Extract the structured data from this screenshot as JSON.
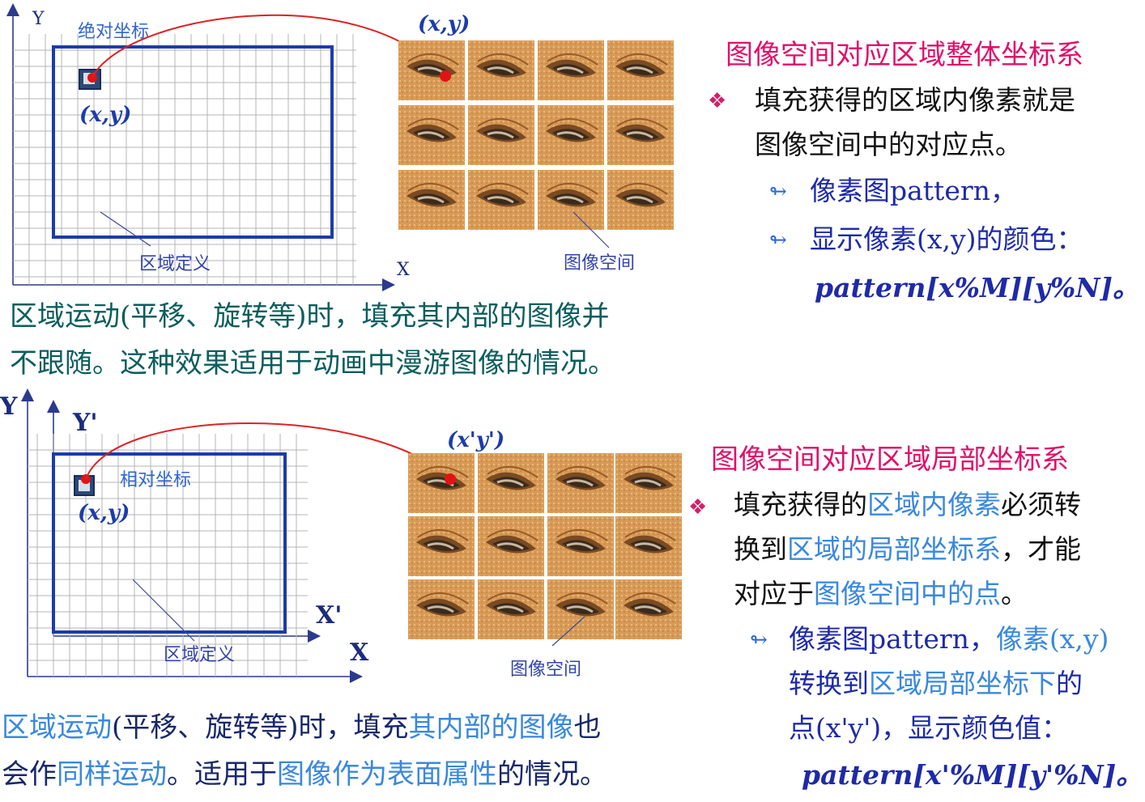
{
  "top": {
    "axis_y": "Y",
    "axis_x": "X",
    "abs_coord_label": "绝对坐标",
    "point_label": "(x,y)",
    "pattern_point_label": "(x,y)",
    "region_label": "区域定义",
    "image_space_label": "图像空间",
    "heading": "图像空间对应区域整体坐标系",
    "bullet_line1": "填充获得的区域内像素就是",
    "bullet_line2": "图像空间中的对应点。",
    "sub1": "像素图pattern，",
    "sub2": "显示像素(x,y)的颜色：",
    "formula": "pattern[x%M][y%N]。",
    "caption_line1": "区域运动(平移、旋转等)时，填充其内部的图像并",
    "caption_line2": "不跟随。这种效果适用于动画中漫游图像的情况。"
  },
  "bottom": {
    "axis_y": "Y",
    "axis_y_prime": "Y'",
    "axis_x": "X",
    "axis_x_prime": "X'",
    "rel_coord_label": "相对坐标",
    "point_label": "(x,y)",
    "pattern_point_label": "(x'y')",
    "region_label": "区域定义",
    "image_space_label": "图像空间",
    "heading": "图像空间对应区域局部坐标系",
    "bullet_l1_a": "填充获得的",
    "bullet_l1_b": "区域内像素",
    "bullet_l1_c": "必须转",
    "bullet_l2_a": "换到",
    "bullet_l2_b": "区域的局部坐标系",
    "bullet_l2_c": "，才能",
    "bullet_l3_a": "对应于",
    "bullet_l3_b": "图像空间中的点",
    "bullet_l3_c": "。",
    "sub_l1_a": "像素图pattern，",
    "sub_l1_b": "像素(x,y)",
    "sub_l2_a": "转换到",
    "sub_l2_b": "区域局部坐标下",
    "sub_l2_c": "的",
    "sub_l3": "点(x'y')，显示颜色值：",
    "formula": "pattern[x'%M][y'%N]。",
    "caption_l1_a": "区域运动",
    "caption_l1_b": "(平移、旋转等)时，填充",
    "caption_l1_c": "其内部的图像",
    "caption_l1_d": "也",
    "caption_l2_a": "会作",
    "caption_l2_b": "同样运动",
    "caption_l2_c": "。适用于",
    "caption_l2_d": "图像作为表面属性",
    "caption_l2_e": "的情况。"
  },
  "colors": {
    "heading": "#e0106a",
    "region_border": "#1c3ca8",
    "highlight": "#3a88dd",
    "curve": "#dd2222",
    "caption_top": "#0b5d5d"
  },
  "icons": {
    "bullet": "four-diamond-bullet-icon",
    "sub_bullet": "swirl-bullet-icon"
  }
}
